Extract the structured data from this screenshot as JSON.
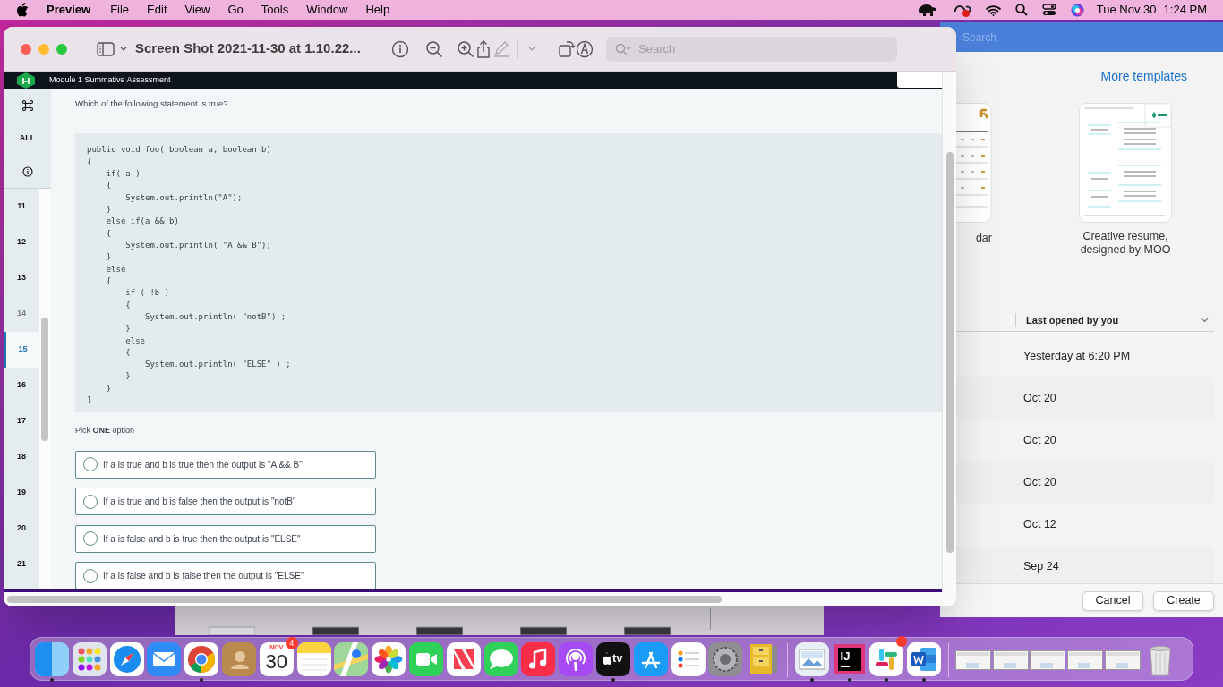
{
  "menubar": {
    "app": "Preview",
    "menus": [
      "File",
      "Edit",
      "View",
      "Go",
      "Tools",
      "Window",
      "Help"
    ],
    "date": "Tue Nov 30",
    "time": "1:24 PM"
  },
  "preview": {
    "title": "Screen Shot 2021-11-30 at 1.10.22...",
    "search_placeholder": "Search",
    "page": {
      "header_title": "Module 1 Summative Assessment",
      "sidebar_top": [
        {
          "kind": "command"
        },
        {
          "kind": "text",
          "label": "ALL"
        },
        {
          "kind": "info"
        }
      ],
      "questions": [
        {
          "label": "11",
          "selected": false,
          "dimmed": false
        },
        {
          "label": "12",
          "selected": false,
          "dimmed": false
        },
        {
          "label": "13",
          "selected": false,
          "dimmed": false
        },
        {
          "label": "14",
          "selected": false,
          "dimmed": true
        },
        {
          "label": "15",
          "selected": true,
          "dimmed": false
        },
        {
          "label": "16",
          "selected": false,
          "dimmed": false
        },
        {
          "label": "17",
          "selected": false,
          "dimmed": false
        },
        {
          "label": "18",
          "selected": false,
          "dimmed": false
        },
        {
          "label": "19",
          "selected": false,
          "dimmed": false
        },
        {
          "label": "20",
          "selected": false,
          "dimmed": false
        },
        {
          "label": "21",
          "selected": false,
          "dimmed": false
        }
      ],
      "question": "Which of the following statement is true?",
      "code": [
        "public void foo( boolean a, boolean b)",
        "{",
        "    if( a )",
        "    {",
        "        System.out.println(\"A\");",
        "    }",
        "    else if(a && b)",
        "    {",
        "        System.out.println( \"A && B\");",
        "    }",
        "    else",
        "    {",
        "        if ( !b )",
        "        {",
        "            System.out.println( \"notB\") ;",
        "        }",
        "        else",
        "        {",
        "            System.out.println( \"ELSE\" ) ;",
        "        }",
        "    }",
        "}"
      ],
      "prompt": "Pick **ONE** option",
      "options": [
        {
          "label": "If a is true and b is true then the output is \"A && B\"",
          "selected": false
        },
        {
          "label": "If a is true and b is false then the output is \"notB\"",
          "selected": false
        },
        {
          "label": "If a is false and b is true then the output is \"ELSE\"",
          "selected": false
        },
        {
          "label": "If a is false and b is false then the output is \"ELSE\"",
          "selected": false
        }
      ]
    }
  },
  "word": {
    "search_placeholder": "Search",
    "more_templates": "More templates",
    "templates": [
      {
        "kind": "calendar",
        "label": "dar"
      },
      {
        "kind": "resume",
        "label": "Creative resume, designed by MOO"
      }
    ],
    "column": "Last opened by you",
    "rows": [
      "Yesterday at 6:20 PM",
      "Oct 20",
      "Oct 20",
      "Oct 20",
      "Oct 12",
      "Sep 24"
    ],
    "buttons": [
      "Cancel",
      "Create"
    ]
  },
  "dock": [
    {
      "kind": "finder",
      "running": true
    },
    {
      "kind": "launchpad",
      "running": false
    },
    {
      "kind": "safari",
      "running": false
    },
    {
      "kind": "mail",
      "running": false
    },
    {
      "kind": "chrome",
      "running": true
    },
    {
      "kind": "contacts",
      "running": false
    },
    {
      "kind": "calendar",
      "running": false,
      "month": "NOV",
      "day": "30",
      "badge": "4"
    },
    {
      "kind": "notes",
      "running": false
    },
    {
      "kind": "maps",
      "running": false
    },
    {
      "kind": "photos",
      "running": false
    },
    {
      "kind": "facetime",
      "running": false
    },
    {
      "kind": "news",
      "running": false
    },
    {
      "kind": "messages",
      "running": false
    },
    {
      "kind": "music",
      "running": false
    },
    {
      "kind": "podcasts",
      "running": false
    },
    {
      "kind": "tv",
      "running": true,
      "glyph": "tv"
    },
    {
      "kind": "appstore",
      "running": false
    },
    {
      "kind": "reminders",
      "running": false
    },
    {
      "kind": "settings",
      "running": false
    },
    {
      "kind": "archive",
      "running": false
    },
    {
      "kind": "separator"
    },
    {
      "kind": "preview",
      "running": true
    },
    {
      "kind": "intellij",
      "running": true,
      "glyph": "IJ"
    },
    {
      "kind": "slack",
      "running": true
    },
    {
      "kind": "word",
      "running": true
    },
    {
      "kind": "separator"
    },
    {
      "kind": "window",
      "running": false
    },
    {
      "kind": "window",
      "running": false
    },
    {
      "kind": "window",
      "running": false
    },
    {
      "kind": "window",
      "running": false
    },
    {
      "kind": "window",
      "running": false
    },
    {
      "kind": "trash",
      "running": false
    }
  ]
}
